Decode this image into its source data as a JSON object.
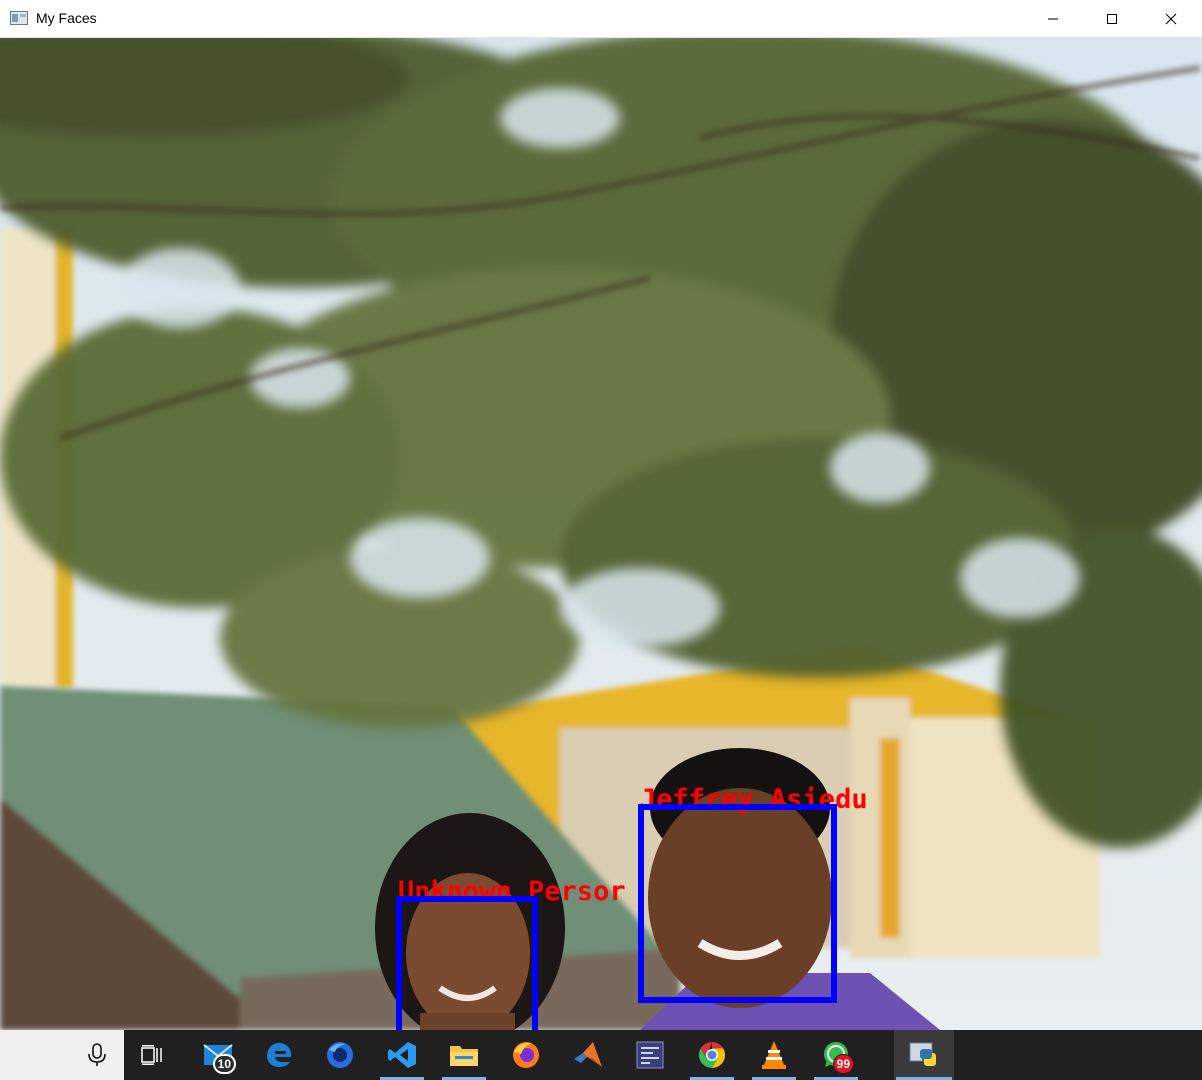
{
  "window": {
    "title": "My Faces",
    "controls": {
      "minimize_icon": "minimize-icon",
      "maximize_icon": "maximize-icon",
      "close_icon": "close-icon"
    }
  },
  "canvas": {
    "faces": [
      {
        "label": "Jeffrey Asiedu",
        "box_color": "#0000ff",
        "label_color": "#ff0000"
      },
      {
        "label": "Unknown Persor",
        "box_color": "#0000ff",
        "label_color": "#ff0000"
      }
    ]
  },
  "taskbar": {
    "items": [
      {
        "icon": "microphone-icon"
      },
      {
        "icon": "task-view-icon"
      },
      {
        "icon": "mail-icon",
        "badge": "10"
      },
      {
        "icon": "edge-icon"
      },
      {
        "icon": "firefox-blue-icon"
      },
      {
        "icon": "vscode-icon"
      },
      {
        "icon": "file-explorer-icon"
      },
      {
        "icon": "firefox-icon"
      },
      {
        "icon": "matlab-icon"
      },
      {
        "icon": "app-grid-icon"
      },
      {
        "icon": "chrome-icon"
      },
      {
        "icon": "vlc-icon"
      },
      {
        "icon": "whatsapp-icon",
        "badge": "99"
      },
      {
        "icon": "python-icon"
      }
    ]
  }
}
